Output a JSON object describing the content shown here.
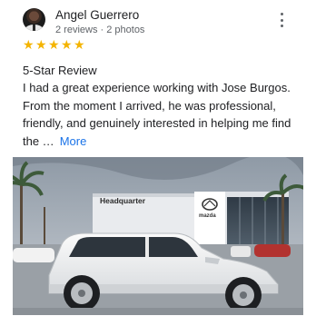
{
  "reviewer": {
    "name": "Angel Guerrero",
    "meta": "2 reviews · 2 photos"
  },
  "rating": {
    "value": 5,
    "max": 5,
    "star_color": "#f4b400"
  },
  "review": {
    "title": "5-Star Review",
    "body": "I had a great experience working with Jose Burgos. From the moment I arrived, he was professional, friendly, and genuinely interested in helping me find the …",
    "more_label": "More"
  },
  "photo": {
    "building_sign": "Headquarter",
    "brand_label": "mazda"
  },
  "icons": {
    "menu": "more-vert-icon",
    "star": "star-icon"
  },
  "colors": {
    "link": "#1a73e8",
    "secondary_text": "#5f6368"
  }
}
